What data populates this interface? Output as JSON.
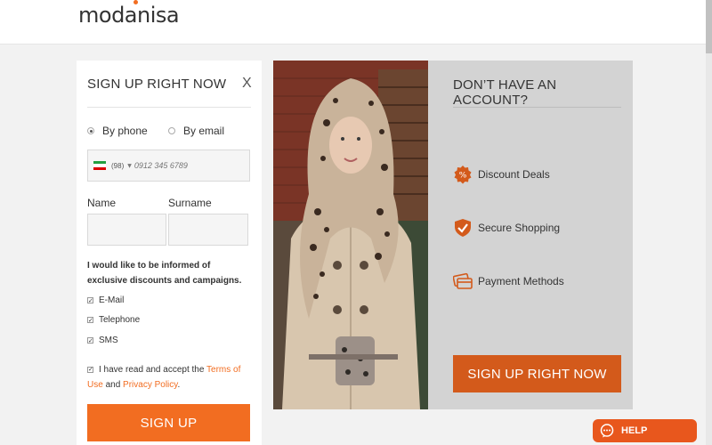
{
  "header": {
    "logo": "modanisa"
  },
  "signup": {
    "title": "SIGN UP RIGHT NOW",
    "close": "X",
    "method_options": [
      {
        "label": "By phone",
        "selected": true
      },
      {
        "label": "By email",
        "selected": false
      }
    ],
    "phone": {
      "country_code": "(98)",
      "placeholder": "0912 345 6789",
      "value": ""
    },
    "name_label": "Name",
    "surname_label": "Surname",
    "inform_text": "I would like to be informed of exclusive discounts and campaigns.",
    "channels": [
      {
        "label": "E-Mail",
        "checked": true
      },
      {
        "label": "Telephone",
        "checked": true
      },
      {
        "label": "SMS",
        "checked": true
      }
    ],
    "terms": {
      "prefix": "I have read and accept the ",
      "terms_link": "Terms of Use",
      "middle": " and ",
      "privacy_link": "Privacy Policy",
      "suffix": ".",
      "checked": true
    },
    "submit_label": "SIGN UP"
  },
  "account": {
    "title": "DON’T HAVE AN ACCOUNT?",
    "features": [
      {
        "label": "Discount Deals",
        "icon": "discount-badge-icon"
      },
      {
        "label": "Secure Shopping",
        "icon": "shield-check-icon"
      },
      {
        "label": "Payment Methods",
        "icon": "credit-cards-icon"
      }
    ],
    "button_label": "SIGN UP RIGHT NOW"
  },
  "help": {
    "label": "HELP",
    "icon": "chat-bubble-icon"
  },
  "colors": {
    "accent": "#f26d21",
    "account_button": "#d35a1b",
    "account_bg": "#d3d3d3"
  }
}
